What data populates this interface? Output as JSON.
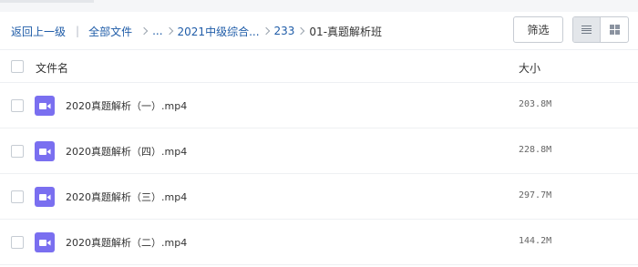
{
  "breadcrumb": {
    "back": "返回上一级",
    "root": "全部文件",
    "ellipsis": "...",
    "folder1": "2021中级综合...",
    "folder2": "233",
    "current": "01-真题解析班"
  },
  "toolbar": {
    "filter_label": "筛选",
    "view_mode": "list"
  },
  "columns": {
    "name": "文件名",
    "size": "大小"
  },
  "files": [
    {
      "name": "2020真题解析（一）.mp4",
      "size": "203.8M",
      "icon": "video-file-icon"
    },
    {
      "name": "2020真题解析（四）.mp4",
      "size": "228.8M",
      "icon": "video-file-icon"
    },
    {
      "name": "2020真题解析（三）.mp4",
      "size": "297.7M",
      "icon": "video-file-icon"
    },
    {
      "name": "2020真题解析（二）.mp4",
      "size": "144.2M",
      "icon": "video-file-icon"
    }
  ],
  "colors": {
    "link": "#1f5ca8",
    "video_icon": "#7a6ff0"
  }
}
